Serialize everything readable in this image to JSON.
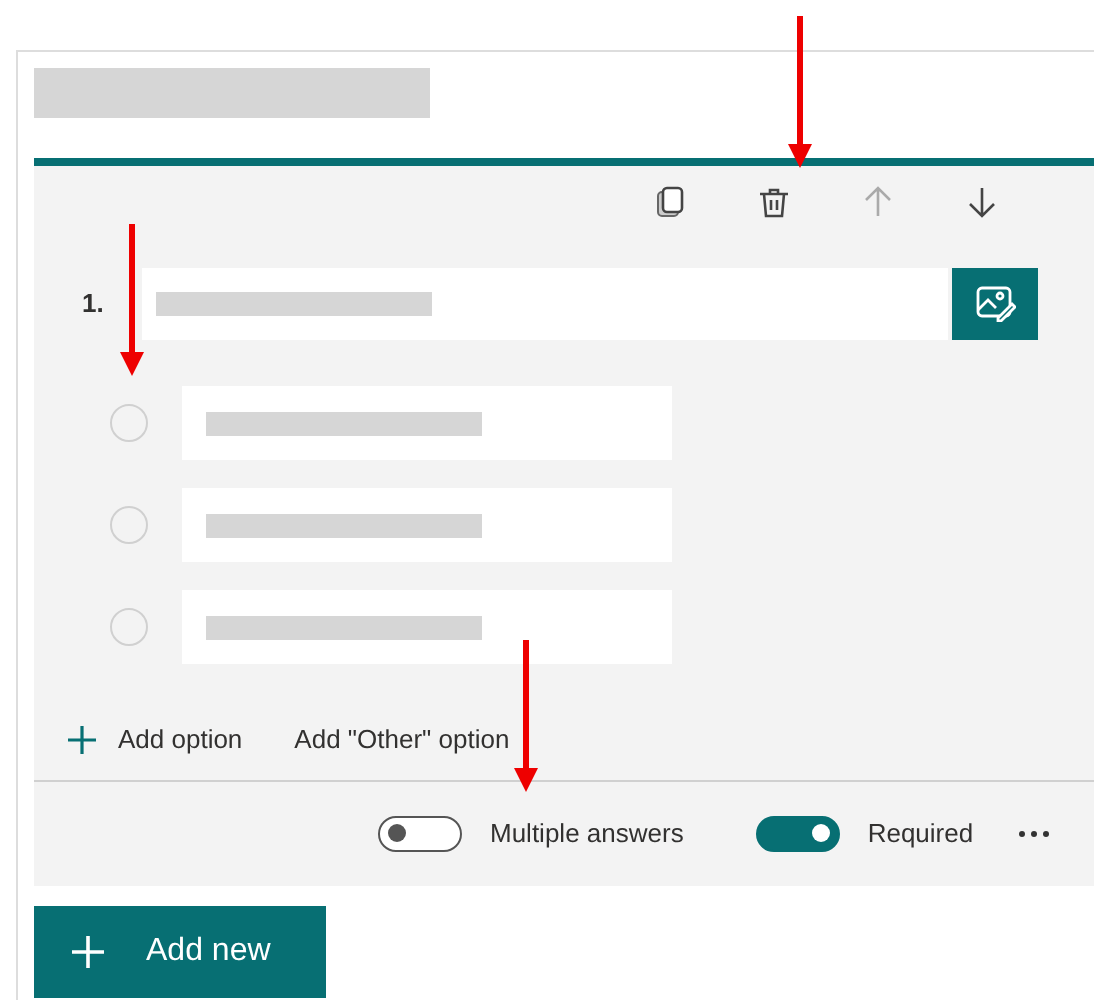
{
  "question": {
    "number": "1."
  },
  "options": [
    {
      "selected": false
    },
    {
      "selected": false
    },
    {
      "selected": false
    }
  ],
  "add_option": "Add option",
  "add_other": "Add \"Other\" option",
  "toggles": [
    {
      "label": "Multiple answers",
      "on": false
    },
    {
      "label": "Required",
      "on": true
    }
  ],
  "add_new": "Add new"
}
